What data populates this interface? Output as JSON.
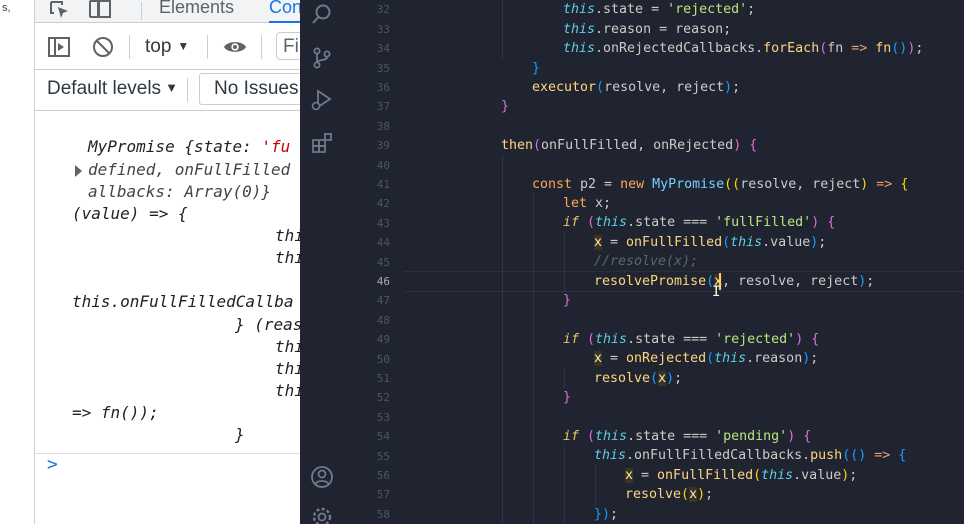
{
  "page": {
    "left_fragment": "s,"
  },
  "devtools": {
    "tabs": {
      "elements": "Elements",
      "console": "Con"
    },
    "toolbar": {
      "context": "top",
      "filter_placeholder": "Fil"
    },
    "levels": {
      "default_levels": "Default levels",
      "no_issues": "No Issues"
    },
    "console_lines": [
      {
        "a": "MyPromise {state: ",
        "b": "'fu"
      },
      {
        "a": "defined, onFullFilled"
      },
      {
        "a": "allbacks: Array(0)}"
      },
      {
        "a": "(value) => {"
      },
      {
        "a": "thi"
      },
      {
        "a": "thi"
      },
      {
        "a": "this.onFullFilledCallba"
      },
      {
        "a": "} (reas"
      },
      {
        "a": "thi"
      },
      {
        "a": "thi"
      },
      {
        "a": "thi"
      },
      {
        "a": "=> fn());"
      },
      {
        "a": "}"
      }
    ],
    "prompt": ">"
  },
  "vscode": {
    "activity_icons": [
      "search-icon",
      "source-control-icon",
      "run-debug-icon",
      "extensions-icon",
      "account-icon",
      "settings-gear-icon"
    ],
    "current_line": 46,
    "line_numbers": [
      "32",
      "33",
      "34",
      "35",
      "36",
      "37",
      "38",
      "39",
      "40",
      "41",
      "42",
      "43",
      "44",
      "45",
      "46",
      "47",
      "48",
      "49",
      "50",
      "51",
      "52",
      "53",
      "54",
      "55",
      "56",
      "57",
      "58"
    ],
    "code": {
      "l32": {
        "kw": "this",
        "p": ".state = ",
        "s": "'rejected'",
        "e": ";"
      },
      "l33": {
        "kw": "this",
        "p": ".reason = reason;"
      },
      "l34": {
        "kw": "this",
        "p": ".onRejectedCallbacks.",
        "fn": "forEach",
        "b1": "(",
        "v": "fn ",
        "op": "=>",
        "v2": " fn",
        "b2": "()",
        "b3": ")",
        "e": ";"
      },
      "l35": {
        "b": "}"
      },
      "l36": {
        "fn": "executor",
        "b1": "(",
        "p": "resolve, reject",
        "b2": ")",
        "e": ";"
      },
      "l37": {
        "b": "}"
      },
      "l39": {
        "fn": "then",
        "b1": "(",
        "p": "onFullFilled, onRejected",
        "b2": ")",
        "sp": " ",
        "b3": "{"
      },
      "l41": {
        "kw": "const",
        "p": " p2 = ",
        "kw2": "new",
        "cls": " MyPromise",
        "b1": "((",
        "p2": "resolve, reject",
        "b2": ")",
        "op": " =>",
        "b3": " {"
      },
      "l42": {
        "kw": "let",
        "p": " x;"
      },
      "l43": {
        "kw": "if",
        "b1": " (",
        "th": "this",
        "p": ".state === ",
        "s": "'fullFilled'",
        "b2": ")",
        "b3": " {"
      },
      "l44": {
        "x": "x",
        "p": " = ",
        "fn": "onFullFilled",
        "b1": "(",
        "th": "this",
        "p2": ".value",
        "b2": ")",
        "e": ";"
      },
      "l45": {
        "cm": "//resolve(x);"
      },
      "l46": {
        "fn": "resolvePromise",
        "b1": "(",
        "x": "x",
        "p": ", resolve, reject",
        "b2": ")",
        "e": ";"
      },
      "l47": {
        "b": "}"
      },
      "l49": {
        "kw": "if",
        "b1": " (",
        "th": "this",
        "p": ".state === ",
        "s": "'rejected'",
        "b2": ")",
        "b3": " {"
      },
      "l50": {
        "x": "x",
        "p": " = ",
        "fn": "onRejected",
        "b1": "(",
        "th": "this",
        "p2": ".reason",
        "b2": ")",
        "e": ";"
      },
      "l51": {
        "fn": "resolve",
        "b1": "(",
        "x": "x",
        "b2": ")",
        "e": ";"
      },
      "l52": {
        "b": "}"
      },
      "l54": {
        "kw": "if",
        "b1": " (",
        "th": "this",
        "p": ".state === ",
        "s": "'pending'",
        "b2": ")",
        "b3": " {"
      },
      "l55": {
        "th": "this",
        "p": ".onFullFilledCallbacks.",
        "fn": "push",
        "b1": "((",
        "b2": ")",
        "op": " =>",
        "b3": " {"
      },
      "l56": {
        "x": "x",
        "p": " = ",
        "fn": "onFullFilled",
        "b1": "(",
        "th": "this",
        "p2": ".value",
        "b2": ")",
        "e": ";"
      },
      "l57": {
        "fn": "resolve",
        "b1": "(",
        "x": "x",
        "b2": ")",
        "e": ";"
      },
      "l58": {
        "b": "})",
        "e": ";"
      }
    }
  }
}
